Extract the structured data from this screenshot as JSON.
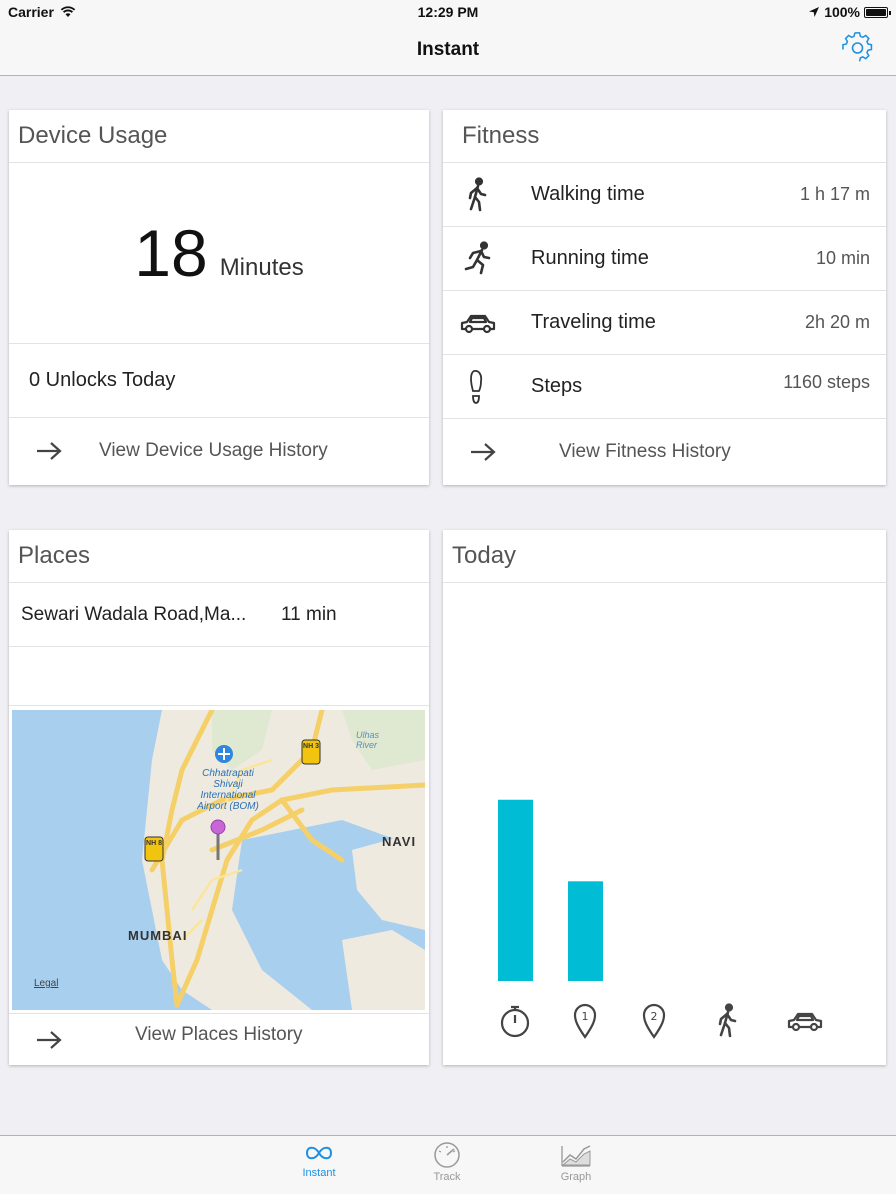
{
  "status_bar": {
    "carrier": "Carrier",
    "time": "12:29 PM",
    "battery": "100%"
  },
  "nav": {
    "title": "Instant"
  },
  "device_usage": {
    "title": "Device Usage",
    "minutes": "18",
    "unit": "Minutes",
    "unlocks": "0 Unlocks Today",
    "history_label": "View Device Usage History"
  },
  "fitness": {
    "title": "Fitness",
    "rows": [
      {
        "icon": "walking-icon",
        "label": "Walking time",
        "value": "1 h 17 m"
      },
      {
        "icon": "running-icon",
        "label": "Running time",
        "value": "10 min"
      },
      {
        "icon": "car-icon",
        "label": "Traveling time",
        "value": "2h 20 m"
      },
      {
        "icon": "footprint-icon",
        "label": "Steps",
        "value": "1160 steps"
      }
    ],
    "history_label": "View Fitness History"
  },
  "places": {
    "title": "Places",
    "items": [
      {
        "name": "Sewari Wadala Road,Ma...",
        "time": "11 min"
      }
    ],
    "history_label": "View Places History",
    "map": {
      "labels": {
        "airport": "Chhatrapati Shivaji International Airport (BOM)",
        "city": "MUMBAI",
        "navi": "NAVI",
        "river": "Ulhas River",
        "legal": "Legal",
        "nh3": "NH 3",
        "nh8": "NH 8"
      }
    }
  },
  "today": {
    "title": "Today",
    "bar_color": "#00bcd4",
    "chart_data": {
      "type": "bar",
      "categories": [
        "device-usage",
        "place-1",
        "place-2",
        "walking",
        "traveling"
      ],
      "category_icons": [
        "stopwatch-icon",
        "place-1-marker-icon",
        "place-2-marker-icon",
        "walking-icon",
        "car-icon"
      ],
      "values": [
        1.0,
        0.55,
        0,
        0,
        0
      ],
      "title": "Today",
      "xlabel": "",
      "ylabel": "",
      "ylim": [
        0,
        1.6
      ]
    }
  },
  "tabs": [
    {
      "label": "Instant",
      "icon": "infinity-icon",
      "active": true
    },
    {
      "label": "Track",
      "icon": "speedometer-icon",
      "active": false
    },
    {
      "label": "Graph",
      "icon": "graph-icon",
      "active": false
    }
  ],
  "colors": {
    "accent": "#1e90e0",
    "inactive_tab": "#999999"
  }
}
